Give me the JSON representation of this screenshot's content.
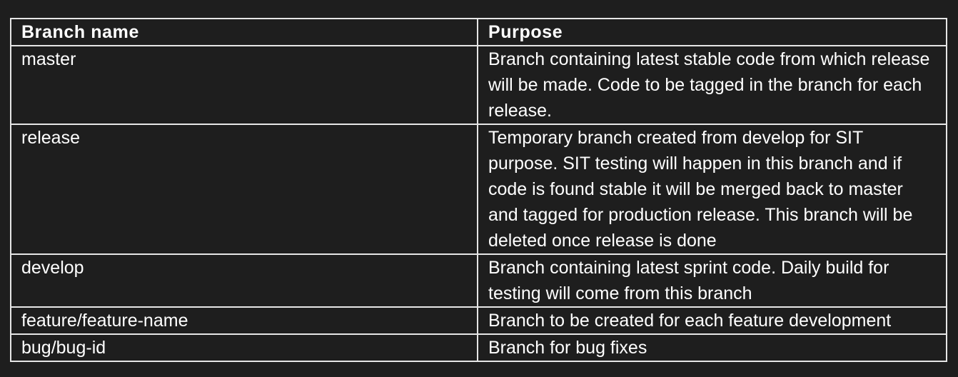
{
  "table": {
    "headers": {
      "branch_name": "Branch name",
      "purpose": "Purpose"
    },
    "rows": [
      {
        "branch": "master",
        "purpose": "Branch containing latest stable code from which release will be made. Code to be tagged in the branch for each release."
      },
      {
        "branch": "release",
        "purpose": "Temporary branch created from develop for SIT purpose. SIT testing will happen in this branch and if code is found stable it will be merged back to master and tagged for production release. This branch will be deleted once release is done"
      },
      {
        "branch": "develop",
        "purpose": "Branch containing latest sprint code. Daily build for testing will come from this branch"
      },
      {
        "branch": "feature/feature-name",
        "purpose": "Branch to be created for each feature development"
      },
      {
        "branch": "bug/bug-id",
        "purpose": "Branch for bug fixes"
      }
    ]
  }
}
